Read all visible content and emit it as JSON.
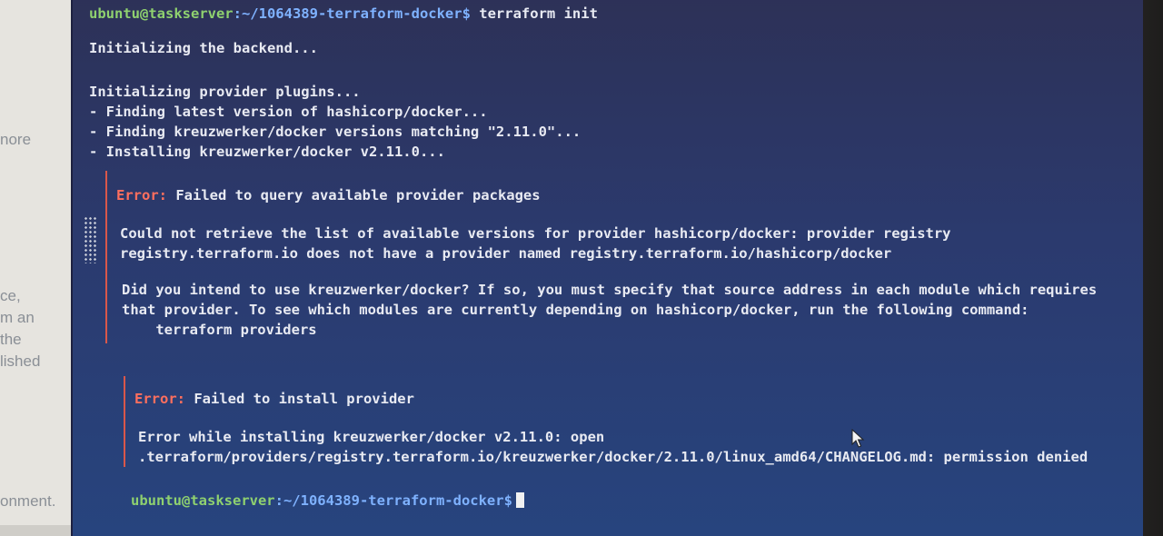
{
  "background_page": {
    "fragments": [
      "nore",
      "ce,",
      "m an",
      "the",
      "lished",
      "onment."
    ]
  },
  "terminal": {
    "command_prompt": {
      "user_host": "ubuntu@taskserver",
      "path": ":~/1064389-terraform-docker$",
      "command": " terraform init"
    },
    "lines": [
      "Initializing the backend...",
      "Initializing provider plugins...",
      "- Finding latest version of hashicorp/docker...",
      "- Finding kreuzwerker/docker versions matching \"2.11.0\"...",
      "- Installing kreuzwerker/docker v2.11.0..."
    ],
    "error1": {
      "label": "Error:",
      "title": " Failed to query available provider packages",
      "body": [
        "Could not retrieve the list of available versions for provider hashicorp/docker: provider registry",
        "registry.terraform.io does not have a provider named registry.terraform.io/hashicorp/docker",
        "Did you intend to use kreuzwerker/docker? If so, you must specify that source address in each module which requires",
        "that provider. To see which modules are currently depending on hashicorp/docker, run the following command:",
        "    terraform providers"
      ]
    },
    "error2": {
      "label": "Error:",
      "title": " Failed to install provider",
      "body": [
        "Error while installing kreuzwerker/docker v2.11.0: open",
        ".terraform/providers/registry.terraform.io/kreuzwerker/docker/2.11.0/linux_amd64/CHANGELOG.md: permission denied"
      ]
    },
    "final_prompt": {
      "user_host": "ubuntu@taskserver",
      "path": ":~/1064389-terraform-docker$"
    }
  }
}
